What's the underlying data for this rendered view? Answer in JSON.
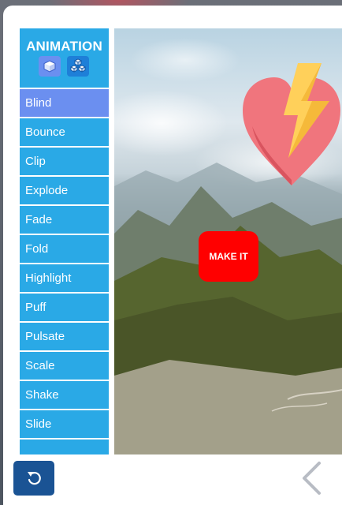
{
  "sidebar": {
    "title": "ANIMATION",
    "items": [
      {
        "label": "Blind",
        "active": true
      },
      {
        "label": "Bounce"
      },
      {
        "label": "Clip"
      },
      {
        "label": "Explode"
      },
      {
        "label": "Fade"
      },
      {
        "label": "Fold"
      },
      {
        "label": "Highlight"
      },
      {
        "label": "Puff"
      },
      {
        "label": "Pulsate"
      },
      {
        "label": "Scale"
      },
      {
        "label": "Shake"
      },
      {
        "label": "Slide"
      }
    ]
  },
  "stage": {
    "button_label": "MAKE IT"
  },
  "icons": {
    "header_icon_1": "cube-icon",
    "header_icon_2": "cubes-icon",
    "reset": "undo-icon",
    "prev": "chevron-left-icon",
    "graphic": "heart-lightning-icon"
  },
  "colors": {
    "menu_bg": "#2aa9e6",
    "menu_active": "#6b8ff0",
    "button_red": "#ff0000",
    "reset_bg": "#1a5394"
  }
}
